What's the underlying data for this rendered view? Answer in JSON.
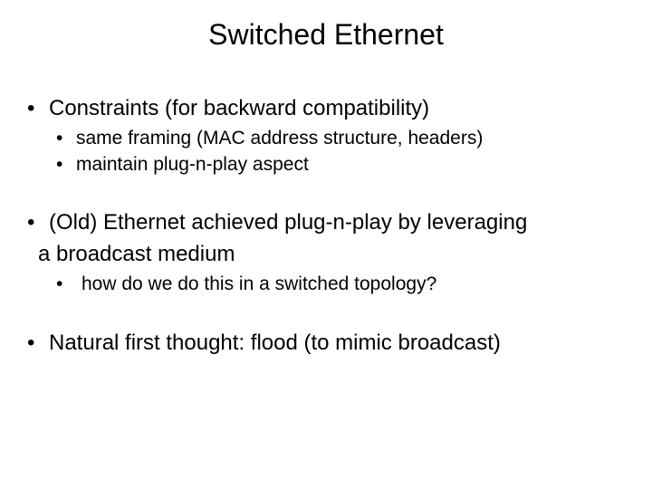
{
  "slide": {
    "title": "Switched Ethernet",
    "b1": {
      "text": "Constraints (for backward compatibility)",
      "sub": [
        "same framing (MAC address structure, headers)",
        "maintain plug-n-play aspect"
      ]
    },
    "b2": {
      "line1": "(Old) Ethernet achieved plug-n-play by leveraging",
      "line2": "a broadcast medium",
      "sub": [
        "how do we do this in a switched topology?"
      ]
    },
    "b3": {
      "text": "Natural first thought: flood (to mimic broadcast)"
    },
    "bullet_char": "•"
  }
}
